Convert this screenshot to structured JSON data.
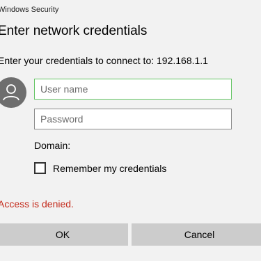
{
  "window": {
    "title": "Windows Security"
  },
  "dialog": {
    "heading": "Enter network credentials",
    "prompt": "Enter your credentials to connect to: 192.168.1.1"
  },
  "form": {
    "username_placeholder": "User name",
    "username_value": "",
    "password_placeholder": "Password",
    "password_value": "",
    "domain_label": "Domain:",
    "remember_label": "Remember my credentials",
    "remember_checked": false
  },
  "status": {
    "error_message": "Access is denied.",
    "error_color": "#c42b1c"
  },
  "buttons": {
    "ok_label": "OK",
    "cancel_label": "Cancel"
  },
  "icons": {
    "avatar": "user-icon"
  },
  "colors": {
    "focus_border": "#62c462",
    "background": "#f2f2f2",
    "button_bg": "#cccccc"
  }
}
